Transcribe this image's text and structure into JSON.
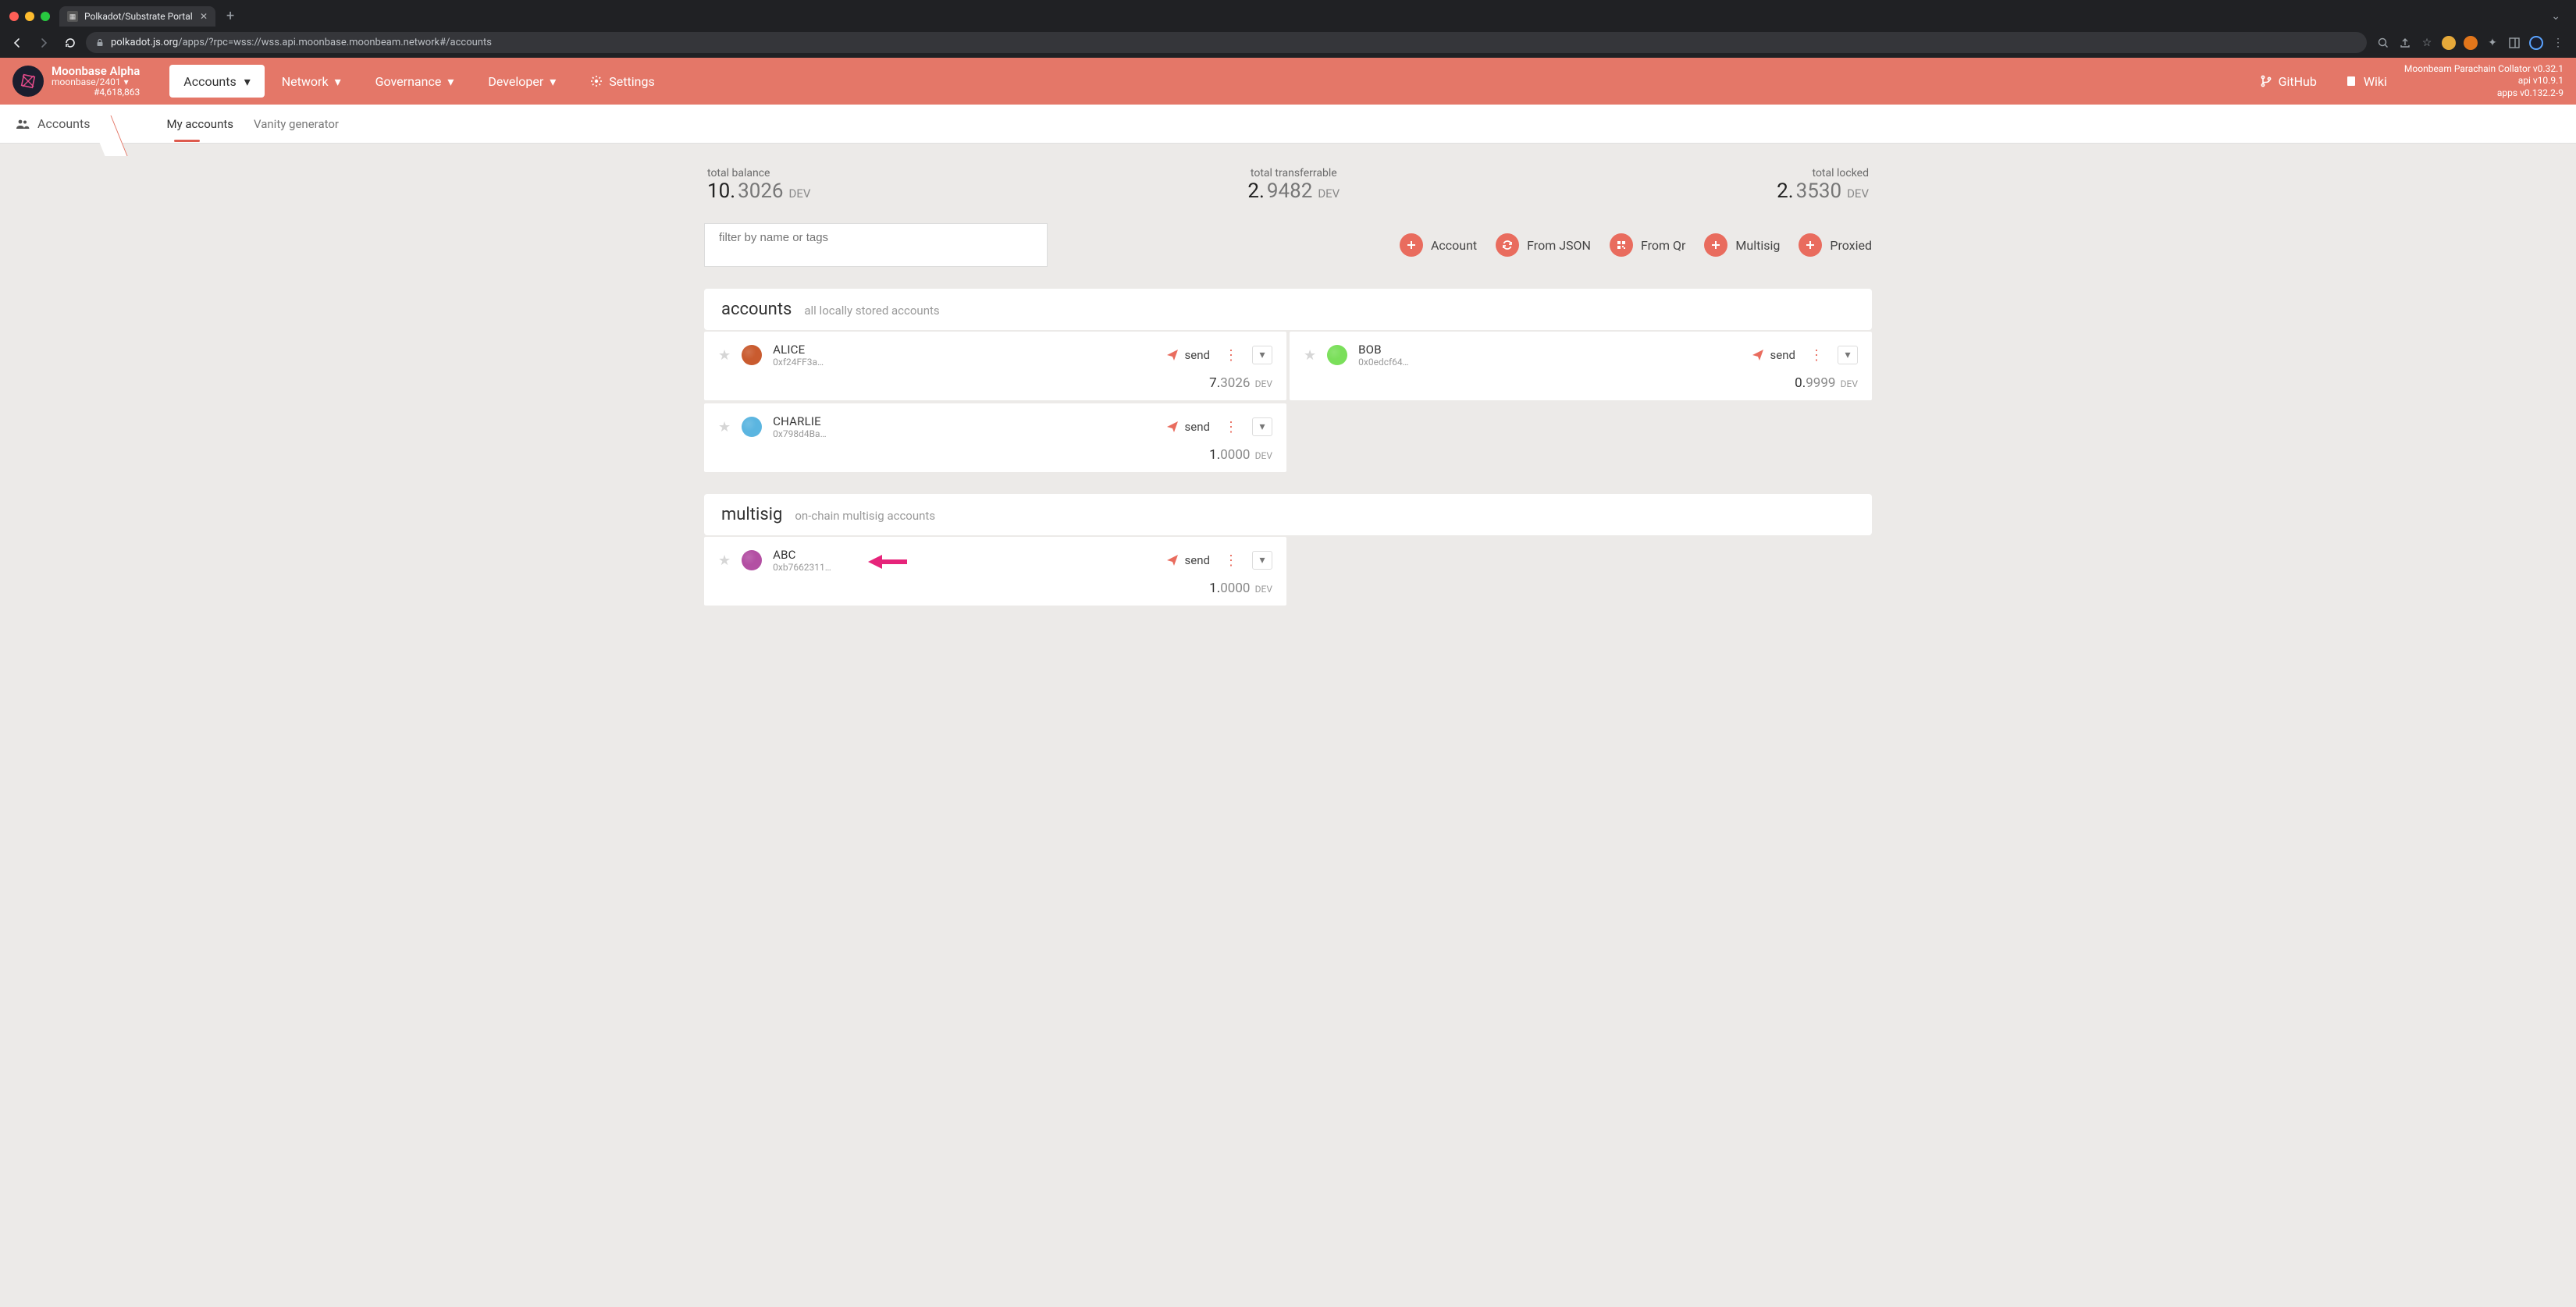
{
  "browser": {
    "tab_title": "Polkadot/Substrate Portal",
    "url_host": "polkadot.js.org",
    "url_path": "/apps/?rpc=wss://wss.api.moonbase.moonbeam.network#/accounts"
  },
  "header": {
    "chain_name": "Moonbase Alpha",
    "chain_sub": "moonbase/2401",
    "block_num": "#4,618,863",
    "nav": {
      "accounts": "Accounts",
      "network": "Network",
      "governance": "Governance",
      "developer": "Developer",
      "settings": "Settings",
      "github": "GitHub",
      "wiki": "Wiki"
    },
    "version": {
      "line1": "Moonbeam Parachain Collator v0.32.1",
      "line2": "api v10.9.1",
      "line3": "apps v0.132.2-9"
    }
  },
  "subnav": {
    "crumb": "Accounts",
    "tabs": {
      "my_accounts": "My accounts",
      "vanity": "Vanity generator"
    }
  },
  "totals": {
    "balance": {
      "label": "total balance",
      "whole": "10.",
      "frac": "3026",
      "unit": "DEV"
    },
    "transferrable": {
      "label": "total transferrable",
      "whole": "2.",
      "frac": "9482",
      "unit": "DEV"
    },
    "locked": {
      "label": "total locked",
      "whole": "2.",
      "frac": "3530",
      "unit": "DEV"
    }
  },
  "toolbar": {
    "filter_placeholder": "filter by name or tags",
    "actions": {
      "account": "Account",
      "from_json": "From JSON",
      "from_qr": "From Qr",
      "multisig": "Multisig",
      "proxied": "Proxied"
    }
  },
  "sections": {
    "accounts": {
      "title": "accounts",
      "sub": "all locally stored accounts"
    },
    "multisig": {
      "title": "multisig",
      "sub": "on-chain multisig accounts"
    }
  },
  "labels": {
    "send": "send"
  },
  "accounts": {
    "alice": {
      "name": "ALICE",
      "addr": "0xf24FF3a…",
      "bal_whole": "7.",
      "bal_frac": "3026",
      "unit": "DEV",
      "avatar_bg": "#c95b2f"
    },
    "bob": {
      "name": "BOB",
      "addr": "0x0edcf64…",
      "bal_whole": "0.",
      "bal_frac": "9999",
      "unit": "DEV",
      "avatar_bg": "#7adf5a"
    },
    "charlie": {
      "name": "CHARLIE",
      "addr": "0x798d4Ba…",
      "bal_whole": "1.",
      "bal_frac": "0000",
      "unit": "DEV",
      "avatar_bg": "#5bb5e0"
    }
  },
  "multisig": {
    "abc": {
      "name": "ABC",
      "addr": "0xb7662311…",
      "bal_whole": "1.",
      "bal_frac": "0000",
      "unit": "DEV",
      "avatar_bg": "#b34fa3"
    }
  }
}
